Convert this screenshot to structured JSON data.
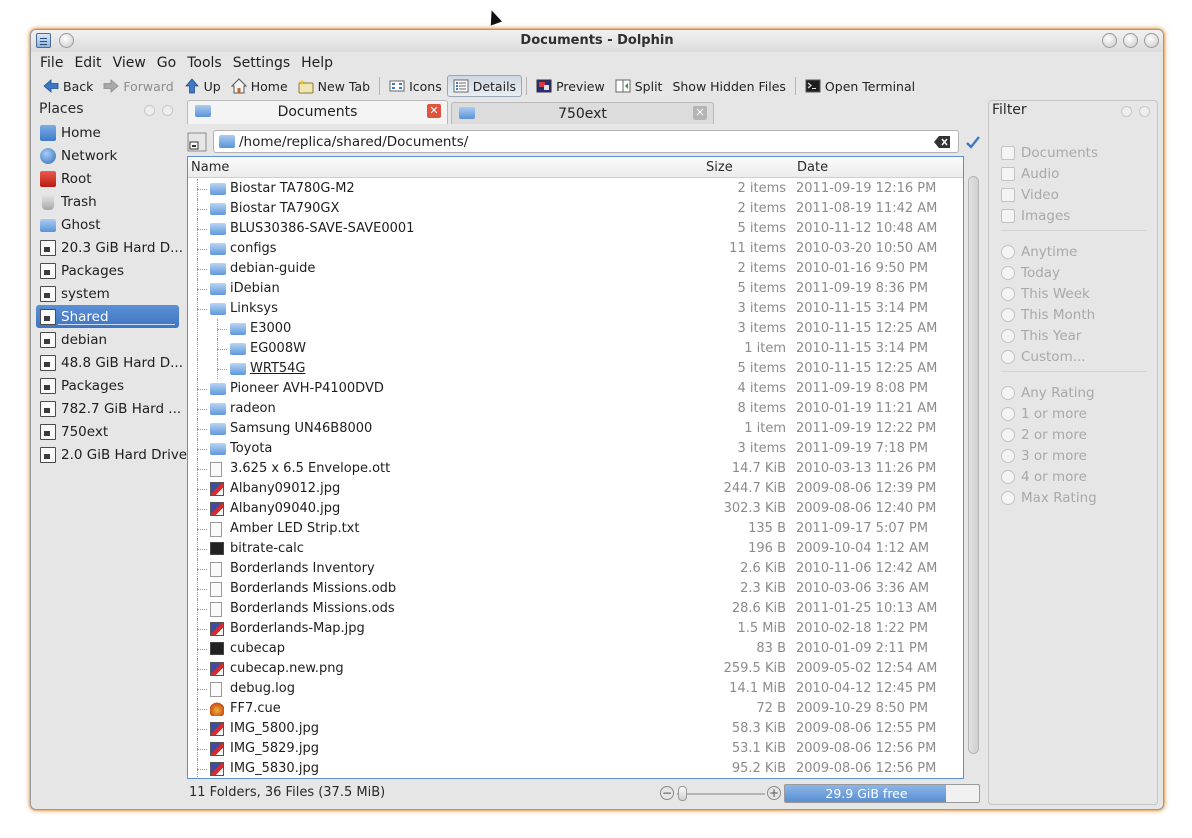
{
  "window": {
    "title": "Documents - Dolphin"
  },
  "menubar": [
    {
      "label": "File"
    },
    {
      "label": "Edit"
    },
    {
      "label": "View"
    },
    {
      "label": "Go"
    },
    {
      "label": "Tools"
    },
    {
      "label": "Settings"
    },
    {
      "label": "Help"
    }
  ],
  "toolbar": {
    "back": "Back",
    "forward": "Forward",
    "up": "Up",
    "home": "Home",
    "new_tab": "New Tab",
    "icons": "Icons",
    "details": "Details",
    "preview": "Preview",
    "split": "Split",
    "show_hidden": "Show Hidden Files",
    "open_terminal": "Open Terminal"
  },
  "places": {
    "title": "Places",
    "items": [
      {
        "label": "Home",
        "icon": "home-icon"
      },
      {
        "label": "Network",
        "icon": "network-icon"
      },
      {
        "label": "Root",
        "icon": "root-folder-icon"
      },
      {
        "label": "Trash",
        "icon": "trash-icon"
      },
      {
        "label": "Ghost",
        "icon": "folder-icon"
      },
      {
        "label": "20.3 GiB Hard D...",
        "icon": "hard-drive-icon"
      },
      {
        "label": "Packages",
        "icon": "hard-drive-icon"
      },
      {
        "label": "system",
        "icon": "hard-drive-icon"
      },
      {
        "label": "Shared",
        "icon": "hard-drive-icon",
        "selected": true
      },
      {
        "label": "debian",
        "icon": "hard-drive-icon"
      },
      {
        "label": "48.8 GiB Hard D...",
        "icon": "hard-drive-icon"
      },
      {
        "label": "Packages",
        "icon": "hard-drive-icon"
      },
      {
        "label": "782.7 GiB Hard ...",
        "icon": "hard-drive-icon"
      },
      {
        "label": "750ext",
        "icon": "hard-drive-icon"
      },
      {
        "label": "2.0 GiB Hard Drive",
        "icon": "hard-drive-icon"
      }
    ]
  },
  "tabs": [
    {
      "label": "Documents",
      "active": true
    },
    {
      "label": "750ext",
      "active": false
    }
  ],
  "location": {
    "path": "/home/replica/shared/Documents/"
  },
  "columns": {
    "name": "Name",
    "size": "Size",
    "date": "Date"
  },
  "files": [
    {
      "name": "Biostar TA780G-M2",
      "size": "2 items",
      "date": "2011-09-19 12:16 PM",
      "type": "folder",
      "depth": 0
    },
    {
      "name": "Biostar TA790GX",
      "size": "2 items",
      "date": "2011-08-19 11:42 AM",
      "type": "folder",
      "depth": 0
    },
    {
      "name": "BLUS30386-SAVE-SAVE0001",
      "size": "5 items",
      "date": "2010-11-12 10:48 AM",
      "type": "folder",
      "depth": 0
    },
    {
      "name": "configs",
      "size": "11 items",
      "date": "2010-03-20 10:50 AM",
      "type": "folder",
      "depth": 0
    },
    {
      "name": "debian-guide",
      "size": "2 items",
      "date": "2010-01-16 9:50 PM",
      "type": "folder",
      "depth": 0
    },
    {
      "name": "iDebian",
      "size": "5 items",
      "date": "2011-09-19 8:36 PM",
      "type": "folder",
      "depth": 0
    },
    {
      "name": "Linksys",
      "size": "3 items",
      "date": "2010-11-15 3:14 PM",
      "type": "folder",
      "depth": 0
    },
    {
      "name": "E3000",
      "size": "3 items",
      "date": "2010-11-15 12:25 AM",
      "type": "folder",
      "depth": 1
    },
    {
      "name": "EG008W",
      "size": "1 item",
      "date": "2010-11-15 3:14 PM",
      "type": "folder",
      "depth": 1
    },
    {
      "name": "WRT54G",
      "size": "5 items",
      "date": "2010-11-15 12:25 AM",
      "type": "folder",
      "depth": 1,
      "underline": true
    },
    {
      "name": "Pioneer AVH-P4100DVD",
      "size": "4 items",
      "date": "2011-09-19 8:08 PM",
      "type": "folder",
      "depth": 0
    },
    {
      "name": "radeon",
      "size": "8 items",
      "date": "2010-01-19 11:21 AM",
      "type": "folder",
      "depth": 0
    },
    {
      "name": "Samsung UN46B8000",
      "size": "1 item",
      "date": "2011-09-19 12:22 PM",
      "type": "folder",
      "depth": 0
    },
    {
      "name": "Toyota",
      "size": "3 items",
      "date": "2011-09-19 7:18 PM",
      "type": "folder",
      "depth": 0
    },
    {
      "name": "3.625 x 6.5 Envelope.ott",
      "size": "14.7 KiB",
      "date": "2010-03-13 11:26 PM",
      "type": "doc",
      "depth": 0
    },
    {
      "name": "Albany09012.jpg",
      "size": "244.7 KiB",
      "date": "2009-08-06 12:39 PM",
      "type": "image",
      "depth": 0
    },
    {
      "name": "Albany09040.jpg",
      "size": "302.3 KiB",
      "date": "2009-08-06 12:40 PM",
      "type": "image",
      "depth": 0
    },
    {
      "name": "Amber LED Strip.txt",
      "size": "135 B",
      "date": "2011-09-17 5:07 PM",
      "type": "doc",
      "depth": 0
    },
    {
      "name": "bitrate-calc",
      "size": "196 B",
      "date": "2009-10-04 1:12 AM",
      "type": "exec",
      "depth": 0
    },
    {
      "name": "Borderlands Inventory",
      "size": "2.6 KiB",
      "date": "2010-11-06 12:42 AM",
      "type": "doc",
      "depth": 0
    },
    {
      "name": "Borderlands Missions.odb",
      "size": "2.3 KiB",
      "date": "2010-03-06 3:36 AM",
      "type": "doc",
      "depth": 0
    },
    {
      "name": "Borderlands Missions.ods",
      "size": "28.6 KiB",
      "date": "2011-01-25 10:13 AM",
      "type": "doc",
      "depth": 0
    },
    {
      "name": "Borderlands-Map.jpg",
      "size": "1.5 MiB",
      "date": "2010-02-18 1:22 PM",
      "type": "image",
      "depth": 0
    },
    {
      "name": "cubecap",
      "size": "83 B",
      "date": "2010-01-09 2:11 PM",
      "type": "exec",
      "depth": 0
    },
    {
      "name": "cubecap.new.png",
      "size": "259.5 KiB",
      "date": "2009-05-02 12:54 AM",
      "type": "image",
      "depth": 0
    },
    {
      "name": "debug.log",
      "size": "14.1 MiB",
      "date": "2010-04-12 12:45 PM",
      "type": "doc",
      "depth": 0
    },
    {
      "name": "FF7.cue",
      "size": "72 B",
      "date": "2009-10-29 8:50 PM",
      "type": "cue",
      "depth": 0
    },
    {
      "name": "IMG_5800.jpg",
      "size": "58.3 KiB",
      "date": "2009-08-06 12:55 PM",
      "type": "image",
      "depth": 0
    },
    {
      "name": "IMG_5829.jpg",
      "size": "53.1 KiB",
      "date": "2009-08-06 12:56 PM",
      "type": "image",
      "depth": 0
    },
    {
      "name": "IMG_5830.jpg",
      "size": "95.2 KiB",
      "date": "2009-08-06 12:56 PM",
      "type": "image",
      "depth": 0
    }
  ],
  "status": {
    "summary": "11 Folders, 36 Files (37.5 MiB)",
    "free_space": "29.9 GiB free",
    "free_fraction": 0.83
  },
  "filter": {
    "title": "Filter",
    "types": [
      "Documents",
      "Audio",
      "Video",
      "Images"
    ],
    "dates": [
      "Anytime",
      "Today",
      "This Week",
      "This Month",
      "This Year",
      "Custom..."
    ],
    "ratings": [
      "Any Rating",
      "1 or more",
      "2 or more",
      "3 or more",
      "4 or more",
      "Max Rating"
    ]
  }
}
